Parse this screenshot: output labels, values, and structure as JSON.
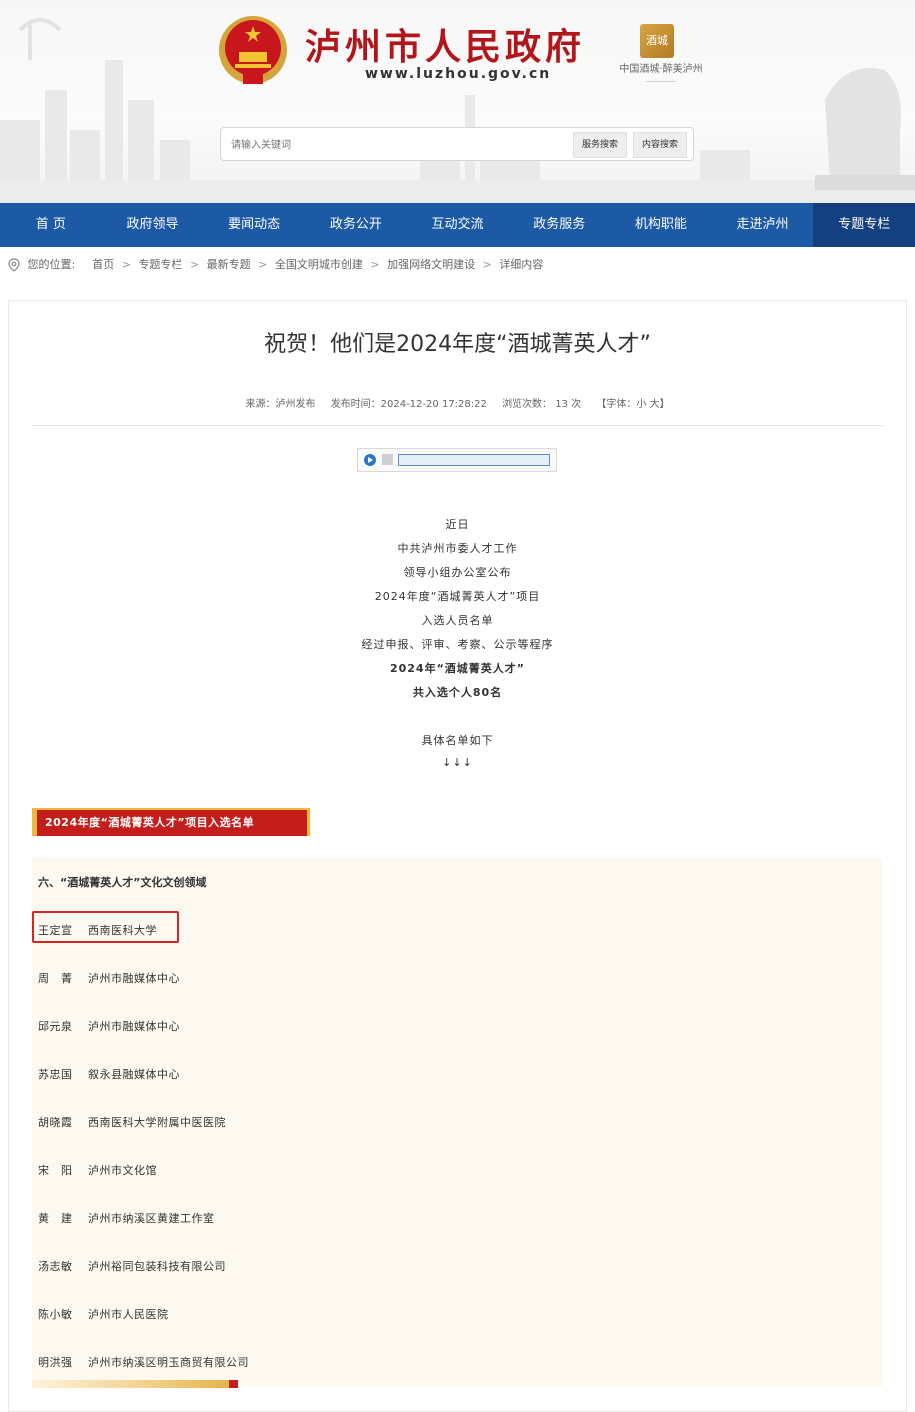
{
  "header": {
    "title": "泸州市人民政府",
    "url": "www.luzhou.gov.cn",
    "brand_badge": "酒城",
    "brand_slogan": "中国酒城·醉美泸州",
    "search": {
      "placeholder": "请输入关键词",
      "service_button": "服务搜索",
      "content_button": "内容搜索"
    }
  },
  "nav": {
    "items": [
      "首 页",
      "政府领导",
      "要闻动态",
      "政务公开",
      "互动交流",
      "政务服务",
      "机构职能",
      "走进泸州",
      "专题专栏"
    ],
    "active_index": 8,
    "color": "#1d5aa6"
  },
  "breadcrumb": {
    "prefix": "您的位置:",
    "items": [
      "首页",
      "专题专栏",
      "最新专题",
      "全国文明城市创建",
      "加强网络文明建设",
      "详细内容"
    ]
  },
  "article": {
    "title": "祝贺！他们是2024年度“酒城菁英人才”",
    "meta": {
      "source": "来源：泸州发布",
      "published": "发布时间：2024-12-20 17:28:22",
      "views": "浏览次数：  13  次",
      "font_size": "【字体：小 大】"
    },
    "intro_lines": [
      "近日",
      "中共泸州市委人才工作",
      "领导小组办公室公布",
      "2024年度“酒城菁英人才”项目",
      "入选人员名单",
      "经过申报、评审、考察、公示等程序"
    ],
    "intro_bold": [
      "2024年“酒城菁英人才”",
      "共入选个人80名"
    ],
    "intro_tail": [
      "具体名单如下",
      "↓↓↓"
    ]
  },
  "list": {
    "banner": "2024年度“酒城菁英人才”项目入选名单",
    "heading": "六、“酒城菁英人才”文化文创领域",
    "rows": [
      {
        "name": "王定宣",
        "org": "西南医科大学"
      },
      {
        "name": "周　菁",
        "org": "泸州市融媒体中心"
      },
      {
        "name": "邱元泉",
        "org": "泸州市融媒体中心"
      },
      {
        "name": "苏忠国",
        "org": "叙永县融媒体中心"
      },
      {
        "name": "胡晓霞",
        "org": "西南医科大学附属中医医院"
      },
      {
        "name": "宋　阳",
        "org": "泸州市文化馆"
      },
      {
        "name": "黄　建",
        "org": "泸州市纳溪区黄建工作室"
      },
      {
        "name": "汤志敏",
        "org": "泸州裕同包装科技有限公司"
      },
      {
        "name": "陈小敏",
        "org": "泸州市人民医院"
      },
      {
        "name": "明洪强",
        "org": "泸州市纳溪区明玉商贸有限公司"
      }
    ],
    "highlighted_index": 0
  },
  "colors": {
    "brand_red": "#b2161b",
    "nav_blue": "#1d5aa6",
    "banner_red": "#c41e1c",
    "banner_gold": "#f2b63a"
  }
}
